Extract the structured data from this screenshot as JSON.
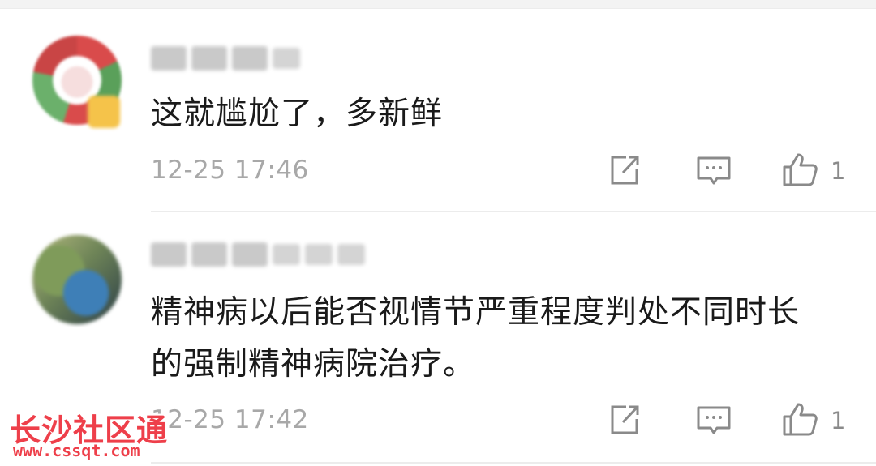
{
  "comments": [
    {
      "username_obscured": "少",
      "text": "这就尴尬了，多新鲜",
      "timestamp": "12-25 17:46",
      "likes": "1",
      "actions": [
        "share-icon",
        "comment-icon",
        "thumbs-up-icon"
      ]
    },
    {
      "username_obscured": "",
      "text": "精神病以后能否视情节严重程度判处不同时长的强制精神病院治疗。",
      "timestamp": "12-25 17:42",
      "likes": "1",
      "actions": [
        "share-icon",
        "comment-icon",
        "thumbs-up-icon"
      ]
    }
  ],
  "watermark": {
    "title": "长沙社区通",
    "url": "www.cssqt.com"
  },
  "colors": {
    "text": "#1a1a1a",
    "meta": "#a8a8a8",
    "icon": "#8a8a8a",
    "watermark": "#ee3f4a"
  }
}
